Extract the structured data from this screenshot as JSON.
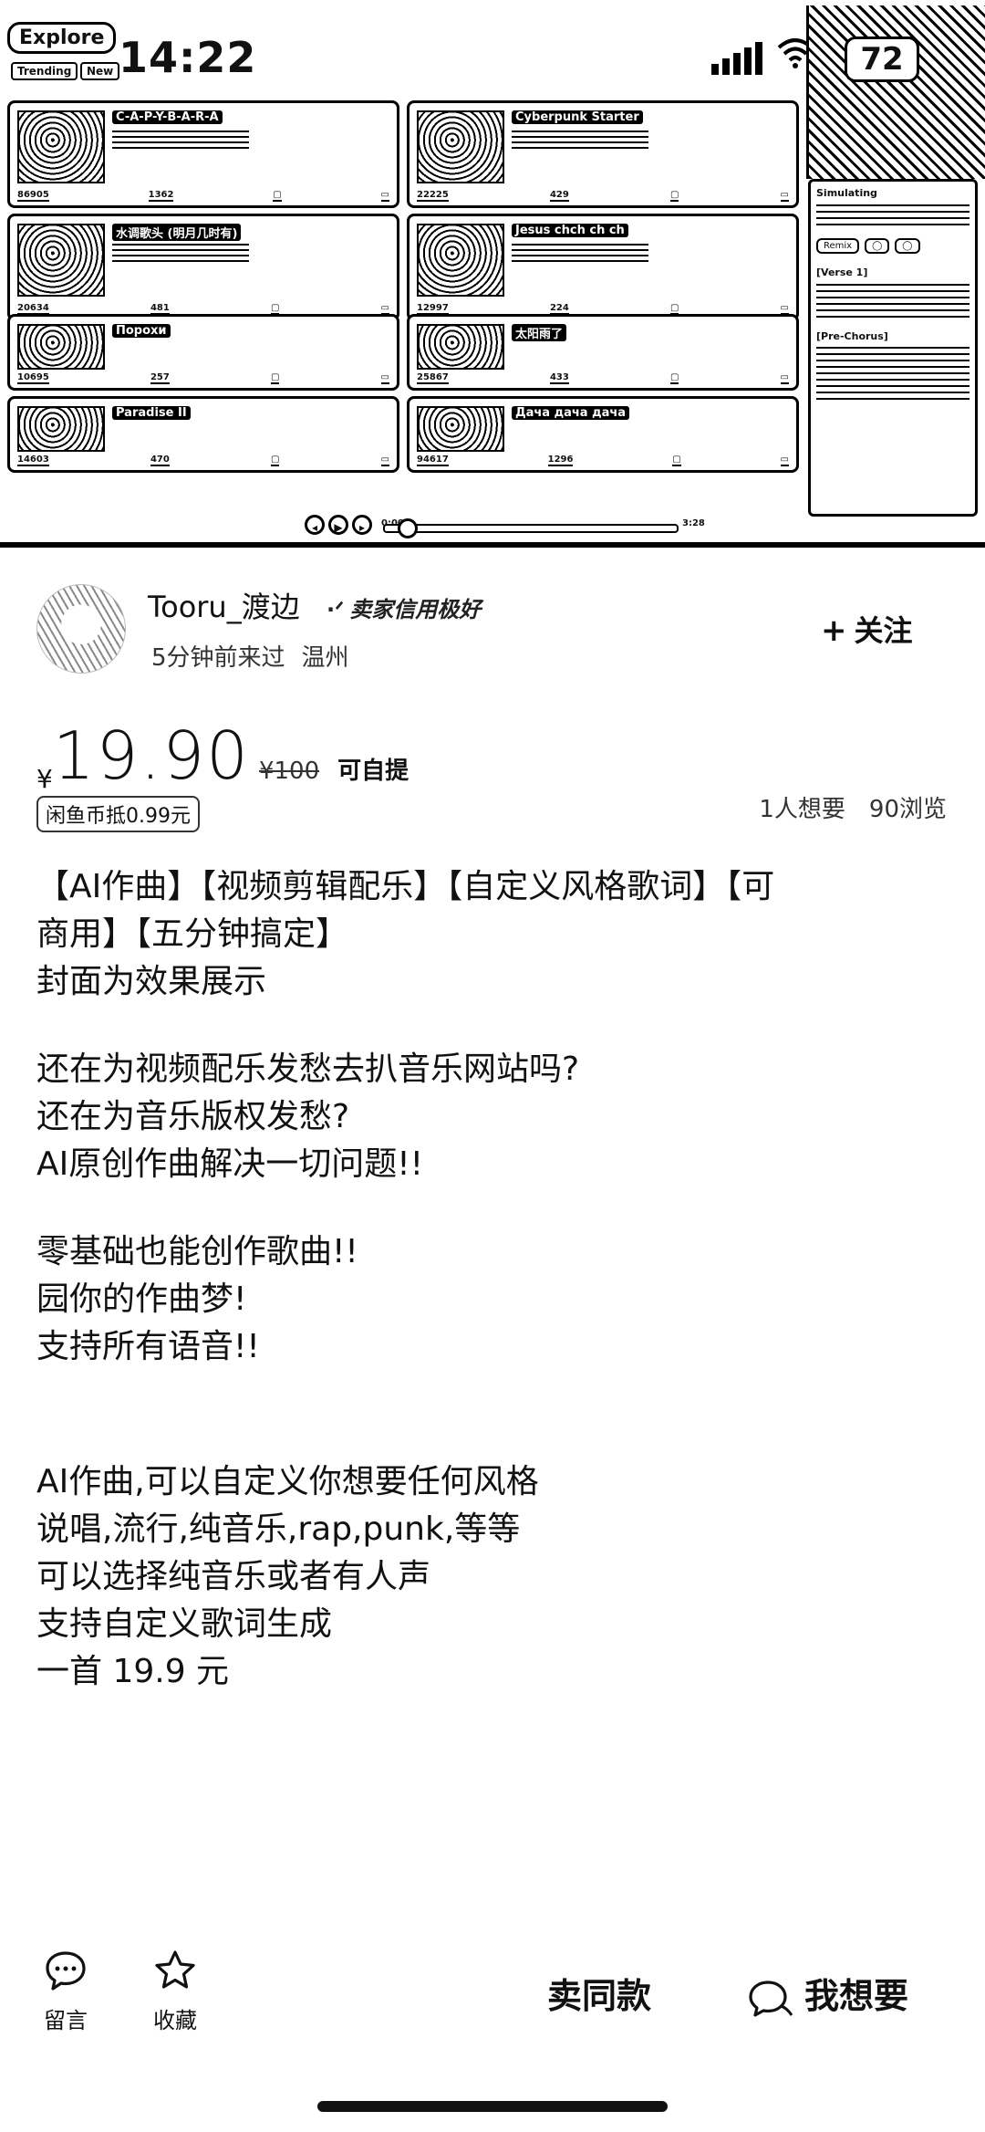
{
  "screenshot": {
    "app_label": "Explore",
    "tabs": [
      "Trending",
      "New"
    ],
    "time": "14:22",
    "battery": "72",
    "cards": [
      {
        "title": "C-A-P-Y-B-A-R-A",
        "plays": "86905",
        "likes": "1362"
      },
      {
        "title": "Cyberpunk Starter",
        "plays": "22225",
        "likes": "429"
      },
      {
        "title": "水调歌头 (明月几时有)",
        "plays": "20634",
        "likes": "481"
      },
      {
        "title": "Jesus chch ch ch",
        "plays": "12997",
        "likes": "224"
      },
      {
        "title": "Порохи",
        "plays": "10695",
        "likes": "257"
      },
      {
        "title": "太阳雨了",
        "plays": "25867",
        "likes": "433"
      },
      {
        "title": "Paradise II",
        "plays": "14603",
        "likes": "470"
      },
      {
        "title": "Дача дача дача",
        "plays": "94617",
        "likes": "1296"
      }
    ],
    "side_panel": {
      "heading": "Simulating",
      "remix": "Remix",
      "verse": "[Verse 1]",
      "prechorus": "[Pre-Chorus]"
    },
    "player": {
      "start": "0:00",
      "end": "3:28"
    }
  },
  "seller": {
    "name": "Tooru_渡边",
    "credit_icon": "·ᐟ",
    "credit": "卖家信用极好",
    "last_seen": "5分钟前来过",
    "city": "温州",
    "follow_label": "关注",
    "follow_plus": "+"
  },
  "price": {
    "currency": "¥",
    "amount": "19.90",
    "original": "¥100",
    "pickup": "可自提",
    "coin_tag": "闲鱼币抵0.99元",
    "wants": "1人想要",
    "views": "90浏览"
  },
  "description": {
    "line1": "【AI作曲】【视频剪辑配乐】【自定义风格歌词】【可",
    "line2": "商用】【五分钟搞定】",
    "line3": "封面为效果展示",
    "line4": "还在为视频配乐发愁去扒音乐网站吗?",
    "line5": "还在为音乐版权发愁?",
    "line6": "AI原创作曲解决一切问题!!",
    "line7": "零基础也能创作歌曲!!",
    "line8": "园你的作曲梦!",
    "line9": "支持所有语音!!",
    "line10": "AI作曲,可以自定义你想要任何风格",
    "line11": "说唱,流行,纯音乐,rap,punk,等等",
    "line12": "可以选择纯音乐或者有人声",
    "line13": "支持自定义歌词生成",
    "line14": "一首 19.9 元"
  },
  "bottom_bar": {
    "comment_label": "留言",
    "favorite_label": "收藏",
    "same_label": "卖同款",
    "want_label": "我想要"
  }
}
